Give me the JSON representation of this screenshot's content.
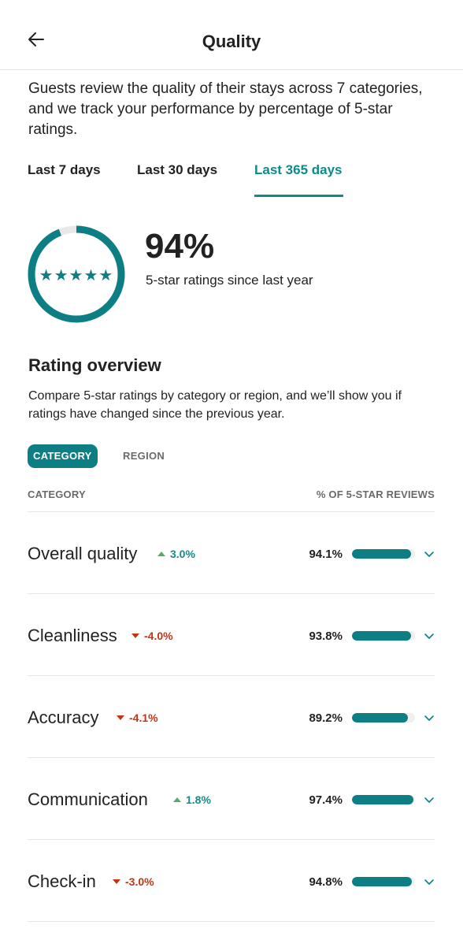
{
  "header": {
    "title": "Quality",
    "back_icon": "arrow-left-icon"
  },
  "intro": "Guests review the quality of their stays across 7 categories, and we track your performance by percentage of 5-star ratings.",
  "tabs": [
    {
      "label": "Last 7 days",
      "active": false
    },
    {
      "label": "Last 30 days",
      "active": false
    },
    {
      "label": "Last 365 days",
      "active": true
    }
  ],
  "summary": {
    "percent": "94%",
    "percent_value": 94,
    "subtitle": "5-star ratings since last year",
    "stars": "★★★★★"
  },
  "overview": {
    "title": "Rating overview",
    "description": "Compare 5-star ratings by category or region, and we’ll show you if ratings have changed since the previous year.",
    "filters": [
      {
        "label": "CATEGORY",
        "active": true
      },
      {
        "label": "REGION",
        "active": false
      }
    ],
    "column_left": "CATEGORY",
    "column_right": "% OF 5-STAR REVIEWS",
    "rows": [
      {
        "name": "Overall quality",
        "change": "3.0%",
        "direction": "up",
        "pct": "94.1%",
        "value": 94.1
      },
      {
        "name": "Cleanliness",
        "change": "-4.0%",
        "direction": "down",
        "pct": "93.8%",
        "value": 93.8
      },
      {
        "name": "Accuracy",
        "change": "-4.1%",
        "direction": "down",
        "pct": "89.2%",
        "value": 89.2
      },
      {
        "name": "Communication",
        "change": "1.8%",
        "direction": "up",
        "pct": "97.4%",
        "value": 97.4
      },
      {
        "name": "Check-in",
        "change": "-3.0%",
        "direction": "down",
        "pct": "94.8%",
        "value": 94.8
      }
    ]
  },
  "colors": {
    "accent": "#0d7f84",
    "tab_active": "#0d8a8a",
    "positive": "#148a8a",
    "negative": "#c13515",
    "ring_track": "#e8e8e8"
  }
}
